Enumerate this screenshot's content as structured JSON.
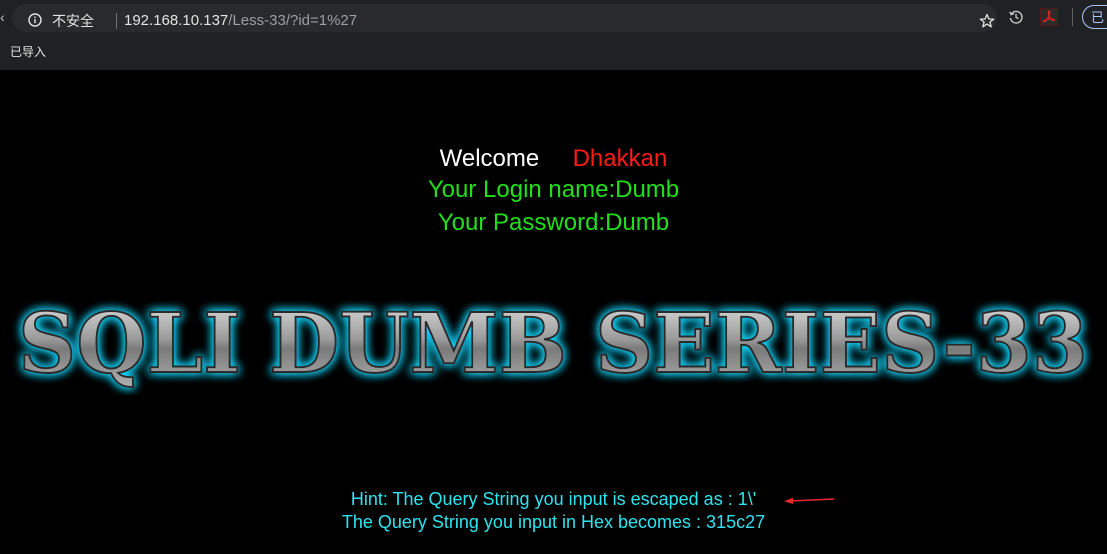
{
  "browser": {
    "security_label": "不安全",
    "url_host": "192.168.10.137",
    "url_path": "/Less-33/?id=1%27",
    "profile_label": "已",
    "bookmark_label": "已导入",
    "icons": [
      "info-icon",
      "star-icon",
      "history-icon",
      "pdf-extension-icon"
    ]
  },
  "page": {
    "welcome_label": "Welcome",
    "welcome_name": "Dhakkan",
    "login_name_line": "Your Login name:Dumb",
    "password_line": "Your Password:Dumb",
    "banner_text": "SQLI DUMB SERIES-33",
    "hint_line": "Hint: The Query String you input is escaped as : 1\\'",
    "hex_line": "The Query String you input in Hex becomes : 315c27"
  },
  "colors": {
    "welcome": "#ffffff",
    "name": "#ff1a1a",
    "credentials": "#21e01b",
    "hint": "#2ee3f0",
    "banner_glow": "#14d8ff",
    "annotation_arrow": "#e8262b"
  }
}
